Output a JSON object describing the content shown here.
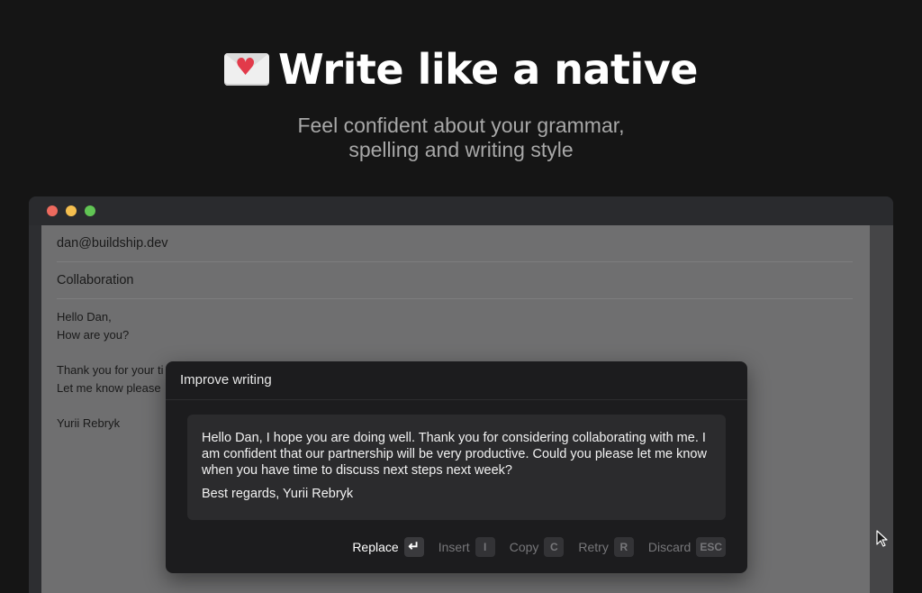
{
  "hero": {
    "icon": "love-letter-icon",
    "title": "Write like a native",
    "subtitle_line1": "Feel confident about your grammar,",
    "subtitle_line2": "spelling and writing style"
  },
  "window": {
    "to": "dan@buildship.dev",
    "subject": "Collaboration",
    "body": {
      "line1": "Hello Dan,",
      "line2": "How are you?",
      "line3": "Thank you for your ti",
      "line4": "Let me know please",
      "line5": "Yurii Rebryk"
    }
  },
  "popup": {
    "title": "Improve writing",
    "suggestion_text": "Hello Dan, I hope you are doing well. Thank you for considering collaborating with me. I am confident that our partnership will be very productive. Could you please let me know when you have time to discuss next steps next week?",
    "signoff": "Best regards, Yurii Rebryk",
    "actions": [
      {
        "label": "Replace",
        "key": "↵"
      },
      {
        "label": "Insert",
        "key": "I"
      },
      {
        "label": "Copy",
        "key": "C"
      },
      {
        "label": "Retry",
        "key": "R"
      },
      {
        "label": "Discard",
        "key": "ESC"
      }
    ]
  },
  "colors": {
    "background": "#151515",
    "traffic_red": "#ed6a5e",
    "traffic_yellow": "#f5bf4f",
    "traffic_green": "#61c554"
  }
}
